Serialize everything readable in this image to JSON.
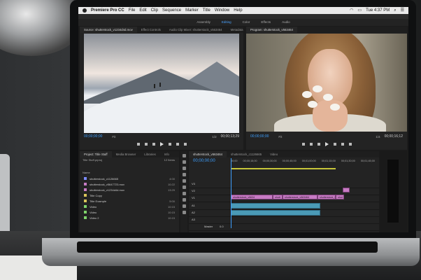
{
  "menubar": {
    "app_name": "Premiere Pro CC",
    "menus": [
      "File",
      "Edit",
      "Clip",
      "Sequence",
      "Marker",
      "Title",
      "Window",
      "Help"
    ],
    "clock": "Tue 4:37 PM"
  },
  "workspaces": [
    "Assembly",
    "Editing",
    "Color",
    "Effects",
    "Audio"
  ],
  "workspace_active": "Editing",
  "source_monitor": {
    "tabs": [
      "Source: shutterstock_v1234d4d.mov",
      "Effect Controls",
      "Audio Clip Mixer: shutterstock_v563464",
      "Metadata"
    ],
    "timecode": "00;00;00;00",
    "fit": "Fit",
    "fraction": "1/2",
    "duration": "00;00;13;29"
  },
  "program_monitor": {
    "tab": "Program: shutterstock_v563464",
    "timecode": "00;00;00;00",
    "fit": "Fit",
    "fraction": "1/4",
    "duration": "00;00;16;12"
  },
  "project_panel": {
    "tabs": [
      "Project: Title Stuff",
      "Media Browser",
      "Libraries",
      "Info"
    ],
    "project_file": "Title Stuff.prproj",
    "item_count": "12 Items",
    "header": "Name",
    "items": [
      {
        "name": "shutterstock_c1126665",
        "color": "#7c8cff",
        "dur": "4:00"
      },
      {
        "name": "shutterstock_v5647723.mov",
        "color": "#c77bc4",
        "dur": "10:22"
      },
      {
        "name": "shutterstock_v1234d4d.mov",
        "color": "#c77bc4",
        "dur": "13:29"
      },
      {
        "name": "Title Copy",
        "color": "#d9c55a",
        "dur": ""
      },
      {
        "name": "Title Example",
        "color": "#d9c55a",
        "dur": "5:00"
      },
      {
        "name": "Video",
        "color": "#7fd46b",
        "dur": "10:15"
      },
      {
        "name": "Video",
        "color": "#7fd46b",
        "dur": "10:15"
      },
      {
        "name": "Video 2",
        "color": "#7fd46b",
        "dur": "10:15"
      }
    ]
  },
  "timeline": {
    "tabs": [
      "shutterstock_v563464",
      "shutterstock_c1126665",
      "Video"
    ],
    "timecode": "00;00;00;00",
    "ruler": [
      "00;00",
      "00;00;15;00",
      "00;00;30;00",
      "00;00;45;00",
      "00;01;00;00",
      "00;01;15;00",
      "00;01;30;00",
      "00;01;45;00"
    ],
    "video_tracks": [
      "V3",
      "V2",
      "V1"
    ],
    "audio_tracks": [
      "A1",
      "A2",
      "A3"
    ],
    "master": "Master",
    "master_value": "0.0",
    "clips": [
      "shutterstock_v5634",
      "shutt",
      "shutterstock_v563464",
      "shutterstock_v5634",
      "shut"
    ]
  }
}
